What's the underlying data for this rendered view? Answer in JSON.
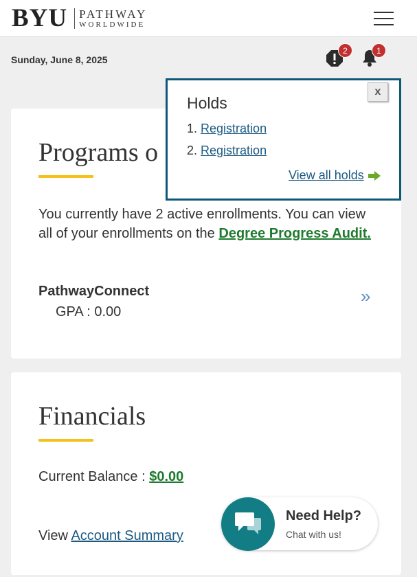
{
  "header": {
    "logo_main": "BYU",
    "logo_line1": "PATHWAY",
    "logo_line2": "WORLDWIDE"
  },
  "date": "Sunday, June 8, 2025",
  "notifications": {
    "holds_count": "2",
    "alerts_count": "1"
  },
  "holds_popup": {
    "title": "Holds",
    "items": [
      {
        "num": "1.",
        "label": "Registration"
      },
      {
        "num": "2.",
        "label": "Registration"
      }
    ],
    "close_label": "x",
    "view_all": "View all holds"
  },
  "programs": {
    "title": "Programs o",
    "text_before": "You currently have 2 active enrollments. You can view all of your enrollments on the ",
    "link": "Degree Progress Audit.",
    "program_name": "PathwayConnect",
    "gpa": "GPA : 0.00"
  },
  "financials": {
    "title": "Financials",
    "balance_label": "Current Balance : ",
    "balance_value": "$0.00",
    "view_label": "View ",
    "view_link": "Account Summary"
  },
  "chat": {
    "title": "Need Help?",
    "subtitle": "Chat with us!"
  },
  "colors": {
    "accent_yellow": "#f5c21b",
    "popup_border": "#0d5878",
    "link_green": "#1e7a2e",
    "link_blue": "#1c5a82",
    "chat_teal": "#127d84",
    "badge_red": "#c0302f"
  }
}
